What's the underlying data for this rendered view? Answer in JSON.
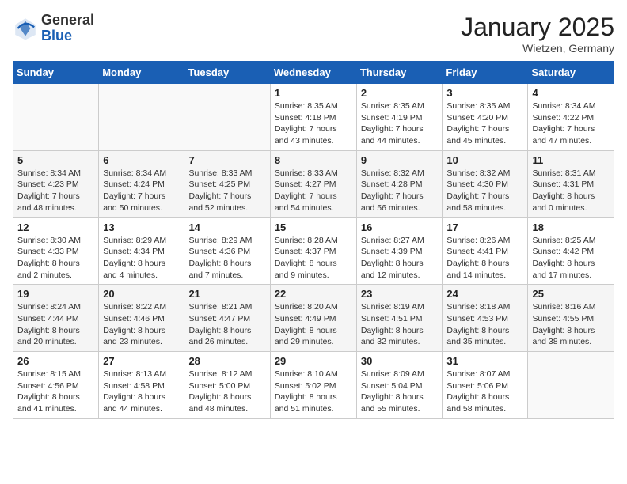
{
  "header": {
    "logo_general": "General",
    "logo_blue": "Blue",
    "month_title": "January 2025",
    "location": "Wietzen, Germany"
  },
  "days_of_week": [
    "Sunday",
    "Monday",
    "Tuesday",
    "Wednesday",
    "Thursday",
    "Friday",
    "Saturday"
  ],
  "weeks": [
    [
      {
        "day": "",
        "info": ""
      },
      {
        "day": "",
        "info": ""
      },
      {
        "day": "",
        "info": ""
      },
      {
        "day": "1",
        "info": "Sunrise: 8:35 AM\nSunset: 4:18 PM\nDaylight: 7 hours\nand 43 minutes."
      },
      {
        "day": "2",
        "info": "Sunrise: 8:35 AM\nSunset: 4:19 PM\nDaylight: 7 hours\nand 44 minutes."
      },
      {
        "day": "3",
        "info": "Sunrise: 8:35 AM\nSunset: 4:20 PM\nDaylight: 7 hours\nand 45 minutes."
      },
      {
        "day": "4",
        "info": "Sunrise: 8:34 AM\nSunset: 4:22 PM\nDaylight: 7 hours\nand 47 minutes."
      }
    ],
    [
      {
        "day": "5",
        "info": "Sunrise: 8:34 AM\nSunset: 4:23 PM\nDaylight: 7 hours\nand 48 minutes."
      },
      {
        "day": "6",
        "info": "Sunrise: 8:34 AM\nSunset: 4:24 PM\nDaylight: 7 hours\nand 50 minutes."
      },
      {
        "day": "7",
        "info": "Sunrise: 8:33 AM\nSunset: 4:25 PM\nDaylight: 7 hours\nand 52 minutes."
      },
      {
        "day": "8",
        "info": "Sunrise: 8:33 AM\nSunset: 4:27 PM\nDaylight: 7 hours\nand 54 minutes."
      },
      {
        "day": "9",
        "info": "Sunrise: 8:32 AM\nSunset: 4:28 PM\nDaylight: 7 hours\nand 56 minutes."
      },
      {
        "day": "10",
        "info": "Sunrise: 8:32 AM\nSunset: 4:30 PM\nDaylight: 7 hours\nand 58 minutes."
      },
      {
        "day": "11",
        "info": "Sunrise: 8:31 AM\nSunset: 4:31 PM\nDaylight: 8 hours\nand 0 minutes."
      }
    ],
    [
      {
        "day": "12",
        "info": "Sunrise: 8:30 AM\nSunset: 4:33 PM\nDaylight: 8 hours\nand 2 minutes."
      },
      {
        "day": "13",
        "info": "Sunrise: 8:29 AM\nSunset: 4:34 PM\nDaylight: 8 hours\nand 4 minutes."
      },
      {
        "day": "14",
        "info": "Sunrise: 8:29 AM\nSunset: 4:36 PM\nDaylight: 8 hours\nand 7 minutes."
      },
      {
        "day": "15",
        "info": "Sunrise: 8:28 AM\nSunset: 4:37 PM\nDaylight: 8 hours\nand 9 minutes."
      },
      {
        "day": "16",
        "info": "Sunrise: 8:27 AM\nSunset: 4:39 PM\nDaylight: 8 hours\nand 12 minutes."
      },
      {
        "day": "17",
        "info": "Sunrise: 8:26 AM\nSunset: 4:41 PM\nDaylight: 8 hours\nand 14 minutes."
      },
      {
        "day": "18",
        "info": "Sunrise: 8:25 AM\nSunset: 4:42 PM\nDaylight: 8 hours\nand 17 minutes."
      }
    ],
    [
      {
        "day": "19",
        "info": "Sunrise: 8:24 AM\nSunset: 4:44 PM\nDaylight: 8 hours\nand 20 minutes."
      },
      {
        "day": "20",
        "info": "Sunrise: 8:22 AM\nSunset: 4:46 PM\nDaylight: 8 hours\nand 23 minutes."
      },
      {
        "day": "21",
        "info": "Sunrise: 8:21 AM\nSunset: 4:47 PM\nDaylight: 8 hours\nand 26 minutes."
      },
      {
        "day": "22",
        "info": "Sunrise: 8:20 AM\nSunset: 4:49 PM\nDaylight: 8 hours\nand 29 minutes."
      },
      {
        "day": "23",
        "info": "Sunrise: 8:19 AM\nSunset: 4:51 PM\nDaylight: 8 hours\nand 32 minutes."
      },
      {
        "day": "24",
        "info": "Sunrise: 8:18 AM\nSunset: 4:53 PM\nDaylight: 8 hours\nand 35 minutes."
      },
      {
        "day": "25",
        "info": "Sunrise: 8:16 AM\nSunset: 4:55 PM\nDaylight: 8 hours\nand 38 minutes."
      }
    ],
    [
      {
        "day": "26",
        "info": "Sunrise: 8:15 AM\nSunset: 4:56 PM\nDaylight: 8 hours\nand 41 minutes."
      },
      {
        "day": "27",
        "info": "Sunrise: 8:13 AM\nSunset: 4:58 PM\nDaylight: 8 hours\nand 44 minutes."
      },
      {
        "day": "28",
        "info": "Sunrise: 8:12 AM\nSunset: 5:00 PM\nDaylight: 8 hours\nand 48 minutes."
      },
      {
        "day": "29",
        "info": "Sunrise: 8:10 AM\nSunset: 5:02 PM\nDaylight: 8 hours\nand 51 minutes."
      },
      {
        "day": "30",
        "info": "Sunrise: 8:09 AM\nSunset: 5:04 PM\nDaylight: 8 hours\nand 55 minutes."
      },
      {
        "day": "31",
        "info": "Sunrise: 8:07 AM\nSunset: 5:06 PM\nDaylight: 8 hours\nand 58 minutes."
      },
      {
        "day": "",
        "info": ""
      }
    ]
  ]
}
